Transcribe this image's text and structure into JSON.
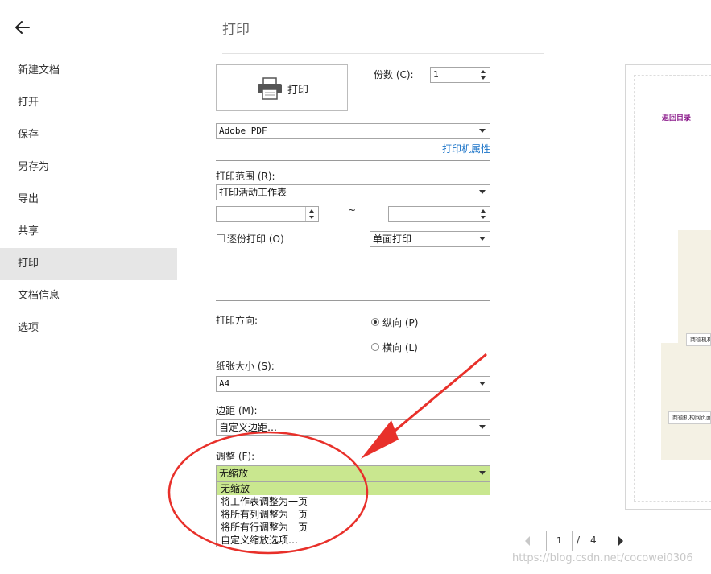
{
  "sidebar": {
    "items": [
      {
        "label": "新建文档"
      },
      {
        "label": "打开"
      },
      {
        "label": "保存"
      },
      {
        "label": "另存为"
      },
      {
        "label": "导出"
      },
      {
        "label": "共享"
      },
      {
        "label": "打印",
        "active": true
      },
      {
        "label": "文档信息"
      },
      {
        "label": "选项"
      }
    ]
  },
  "page": {
    "title": "打印"
  },
  "print": {
    "button_label": "打印",
    "copies_label": "份数 (C):",
    "copies_value": "1",
    "printer": "Adobe PDF",
    "printer_props_link": "打印机属性",
    "range_label": "打印范围 (R):",
    "range_value": "打印活动工作表",
    "range_from": "",
    "range_sep": "~",
    "range_to": "",
    "collate_label": "逐份打印 (O)",
    "collate_checked": false,
    "sides_value": "单面打印",
    "orientation_label": "打印方向:",
    "portrait_label": "纵向 (P)",
    "landscape_label": "横向 (L)",
    "orientation_selected": "portrait",
    "paper_label": "纸张大小 (S):",
    "paper_value": "A4",
    "margin_label": "边距 (M):",
    "margin_value": "自定义边距…",
    "scale_label": "调整 (F):",
    "scale_value": "无缩放",
    "scale_options": [
      "无缩放",
      "将工作表调整为一页",
      "将所有列调整为一页",
      "将所有行调整为一页",
      "自定义缩放选项…"
    ]
  },
  "preview": {
    "toc_link": "返回目录",
    "thumb1": "商德机构",
    "thumb2": "商德机构网页面",
    "current_page": "1",
    "page_sep": "/",
    "total_pages": "4"
  },
  "watermark": "https://blog.csdn.net/cocowei0306",
  "colors": {
    "active_nav": "#e6e6e6",
    "dropdown_highlight": "#c9e78f",
    "link": "#1a73c8",
    "annotation_red": "#e8302a"
  }
}
